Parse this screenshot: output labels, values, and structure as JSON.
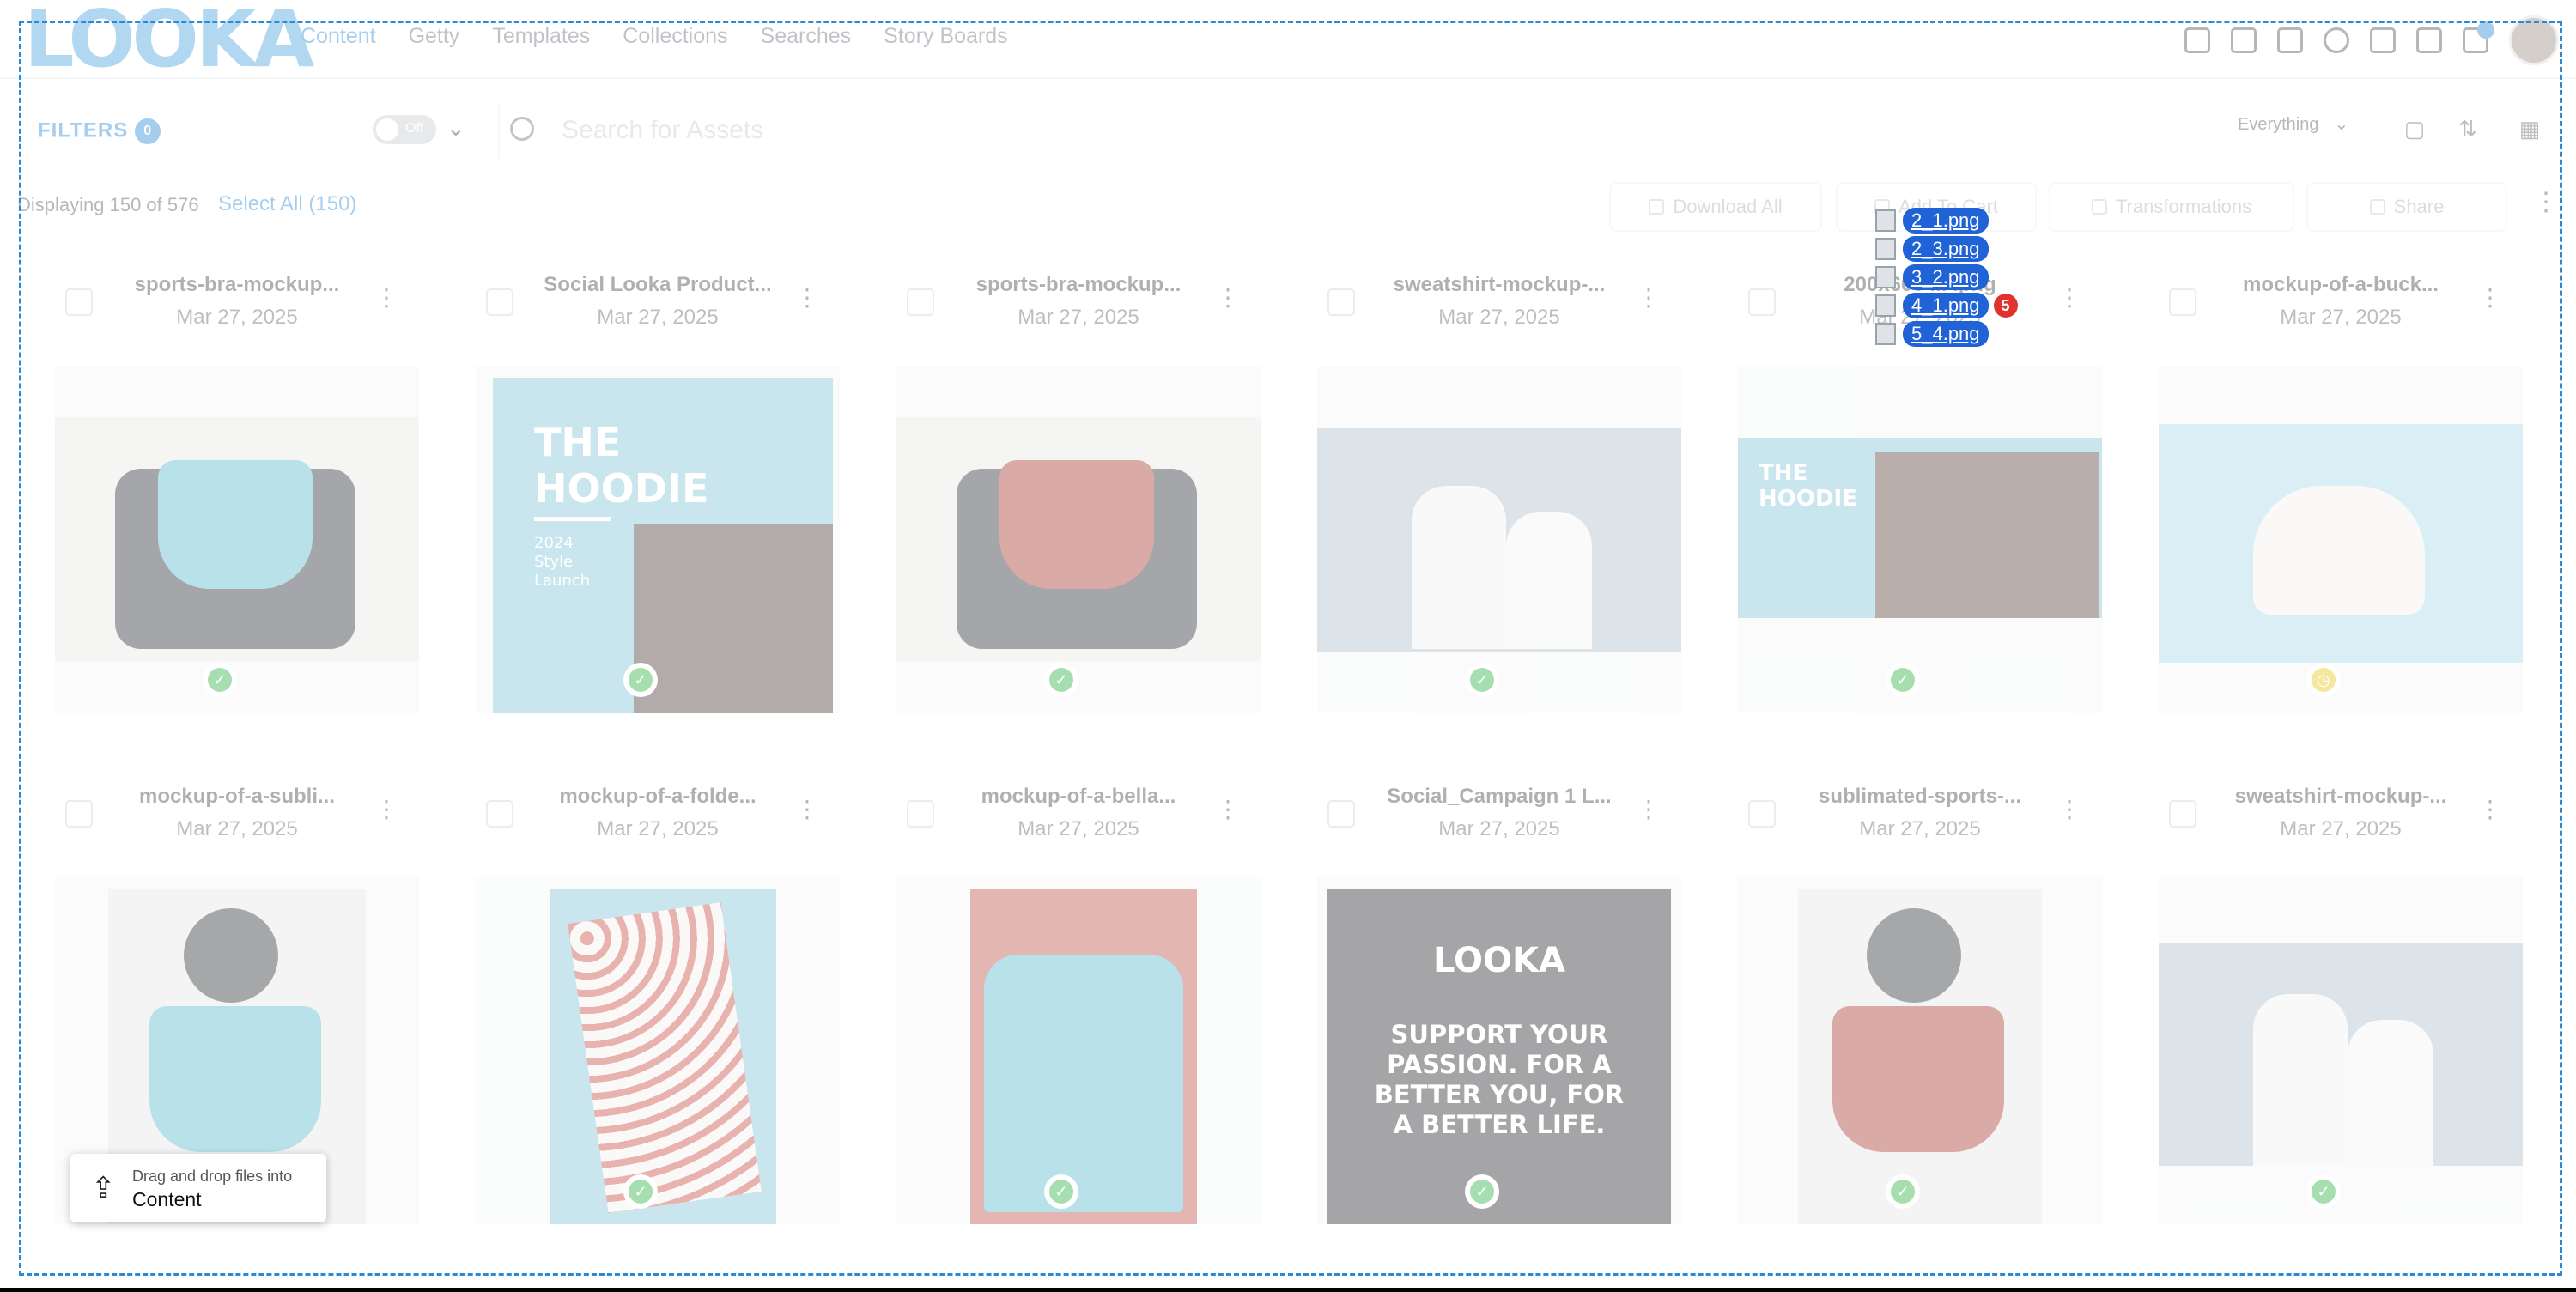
{
  "app": {
    "logo_text": "LOOKA",
    "nav": [
      "Content",
      "Getty",
      "Templates",
      "Collections",
      "Searches",
      "Story Boards"
    ],
    "active_nav": "Content"
  },
  "toolbar": {
    "filters_label": "FILTERS",
    "filters_count": "0",
    "toggle_label": "Off",
    "search_placeholder": "Search for Assets",
    "scope_value": "Everything"
  },
  "actions": {
    "displaying": "Displaying 150 of 576",
    "select_all": "Select All (150)",
    "buttons": [
      "Download All",
      "Add To Cart",
      "Transformations",
      "Share"
    ]
  },
  "assets": [
    {
      "name": "sports-bra-mockup...",
      "date": "Mar 27, 2025",
      "status": "approved",
      "thumb": "blue-bra-bag"
    },
    {
      "name": "Social Looka Product...",
      "date": "Mar 27, 2025",
      "status": "approved",
      "thumb": "hoodie-launch"
    },
    {
      "name": "sports-bra-mockup...",
      "date": "Mar 27, 2025",
      "status": "approved",
      "thumb": "red-bra-bag"
    },
    {
      "name": "sweatshirt-mockup-...",
      "date": "Mar 27, 2025",
      "status": "approved",
      "thumb": "snow-couple"
    },
    {
      "name": "200x600 ... .png",
      "date": "Mar 27, 2025",
      "status": "approved",
      "thumb": "hoodie-banner"
    },
    {
      "name": "mockup-of-a-buck...",
      "date": "Mar 27, 2025",
      "status": "pending",
      "thumb": "bucket-hat"
    },
    {
      "name": "mockup-of-a-subli...",
      "date": "Mar 27, 2025",
      "status": "approved",
      "thumb": "blue-bra-kettlebell"
    },
    {
      "name": "mockup-of-a-folde...",
      "date": "Mar 27, 2025",
      "status": "approved",
      "thumb": "folded-pattern"
    },
    {
      "name": "mockup-of-a-bella...",
      "date": "Mar 27, 2025",
      "status": "approved",
      "thumb": "tshirt-hanger"
    },
    {
      "name": "Social_Campaign 1 L...",
      "date": "Mar 27, 2025",
      "status": "approved",
      "thumb": "campaign"
    },
    {
      "name": "sublimated-sports-...",
      "date": "Mar 27, 2025",
      "status": "approved",
      "thumb": "red-bra-kettlebell"
    },
    {
      "name": "sweatshirt-mockup-...",
      "date": "Mar 27, 2025",
      "status": "approved",
      "thumb": "snow-couple-2"
    }
  ],
  "tiles": {
    "hoodie_title": "THE HOODIE",
    "hoodie_sub": "2024 Style Launch",
    "campaign_logo": "LOOKA",
    "campaign_text": "SUPPORT YOUR PASSION. FOR A BETTER YOU, FOR A BETTER LIFE."
  },
  "drop_hint": {
    "line1": "Drag and drop files into",
    "line2": "Content"
  },
  "drag_ghost": {
    "files": [
      "2_1.png",
      "2_3.png",
      "3_2.png",
      "4_1.png",
      "5_4.png"
    ],
    "count": "5"
  },
  "colors": {
    "accent": "#2b8ad6",
    "approved": "#2fb344",
    "pending": "#e8c91a",
    "ghost_pill": "#1f63d6",
    "ghost_badge": "#e0332e"
  }
}
